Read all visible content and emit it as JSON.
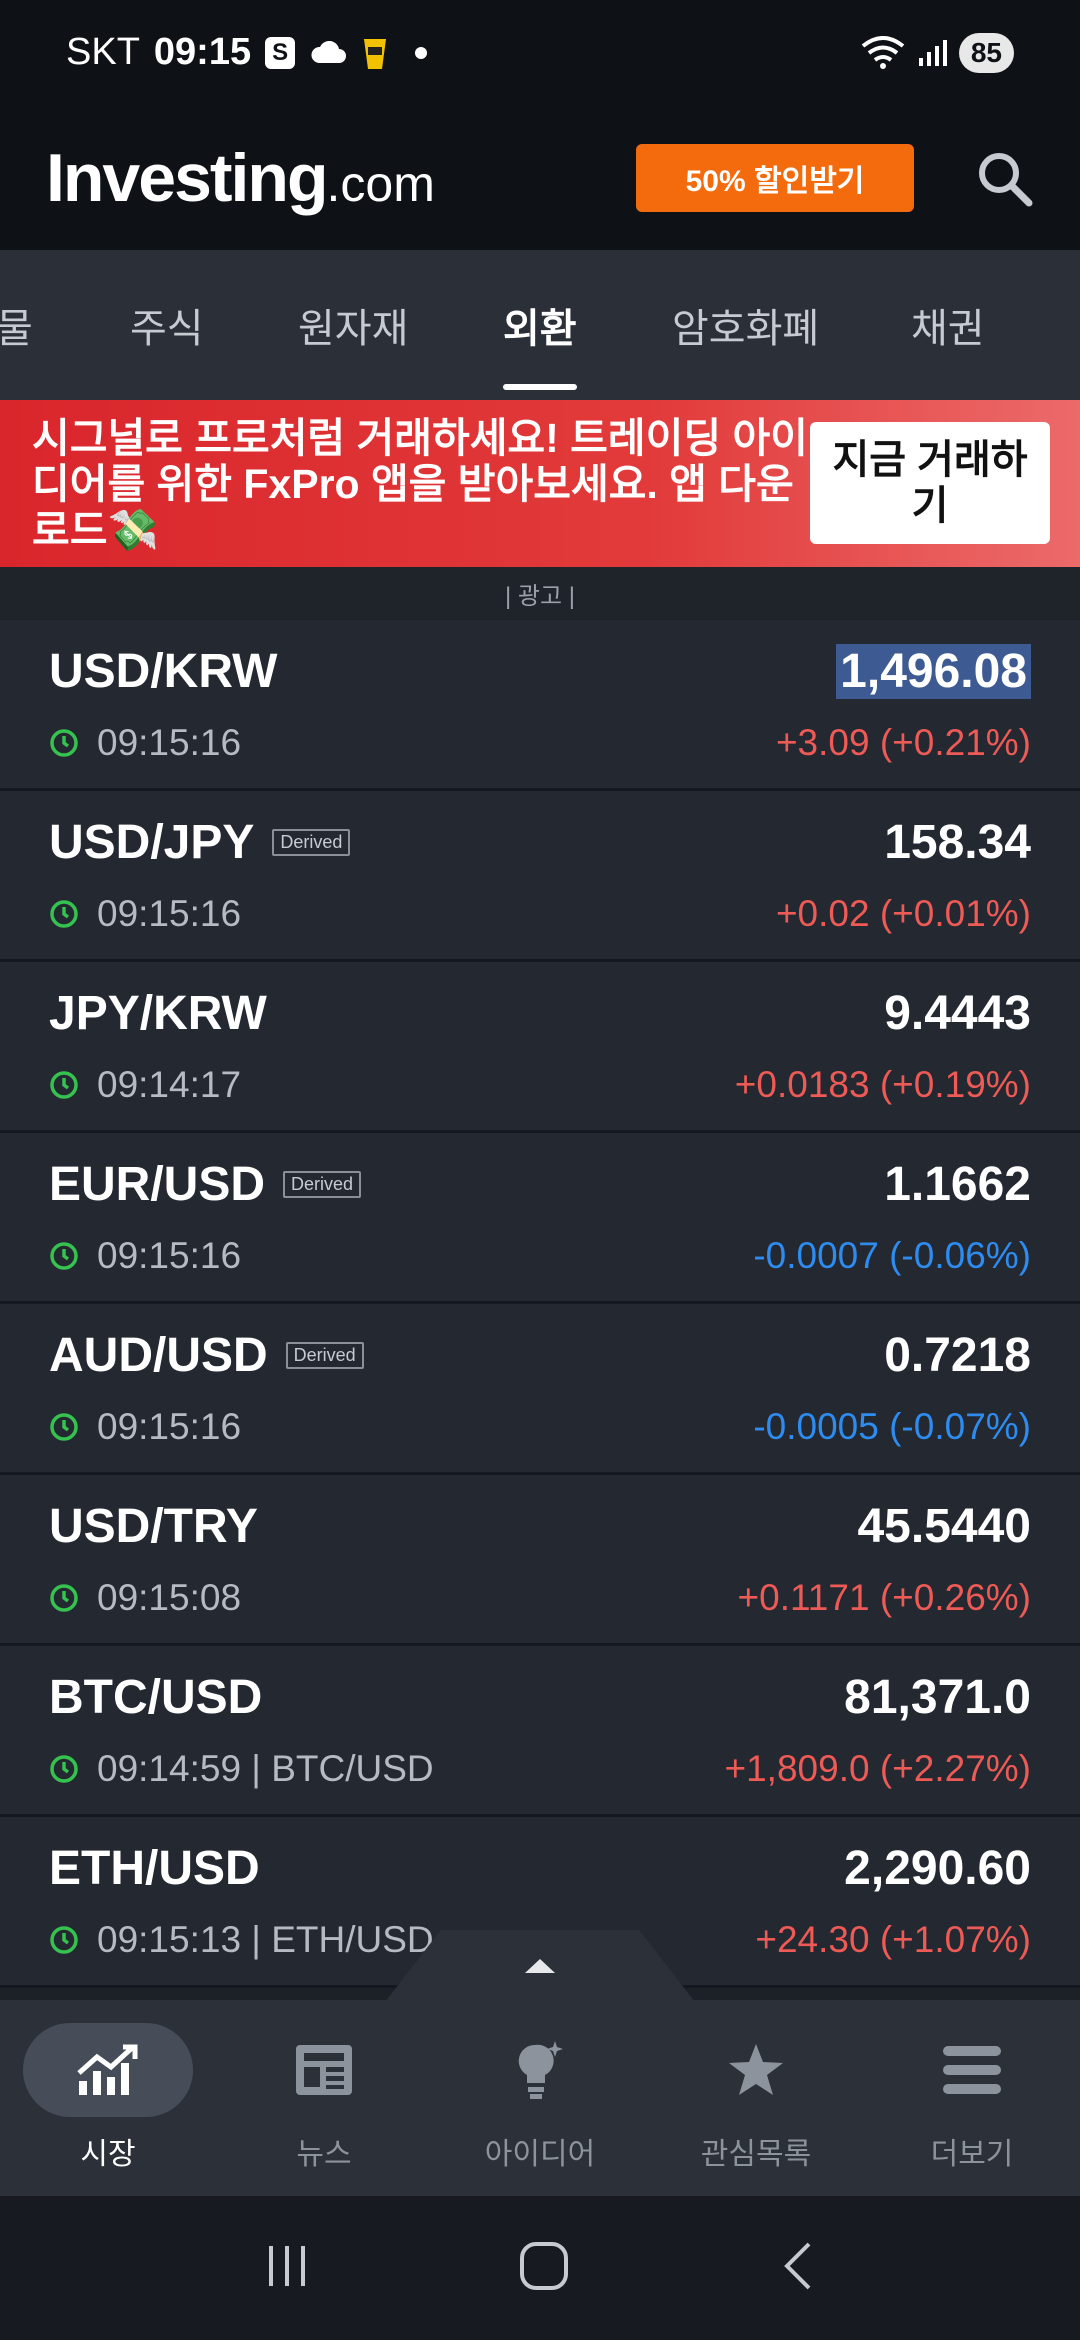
{
  "status_bar": {
    "carrier": "SKT",
    "time": "09:15",
    "battery": "85",
    "icons": [
      "samsung-s-icon",
      "cloud-icon",
      "cup-icon",
      "dot-icon",
      "wifi-icon",
      "signal-icon",
      "battery-icon"
    ]
  },
  "header": {
    "logo_main": "Investing",
    "logo_suffix": ".com",
    "promo_label": "50% 할인받기",
    "search_icon": "search-icon"
  },
  "tabs": [
    {
      "label": "물",
      "active": false
    },
    {
      "label": "주식",
      "active": false
    },
    {
      "label": "원자재",
      "active": false
    },
    {
      "label": "외환",
      "active": true
    },
    {
      "label": "암호화폐",
      "active": false
    },
    {
      "label": "채권",
      "active": false
    }
  ],
  "ad": {
    "text": "시그널로 프로처럼 거래하세요! 트레이딩 아이디어를 위한 FxPro 앱을 받아보세요. 앱 다운로드💸",
    "cta": "지금 거래하기",
    "label": "| 광고 |"
  },
  "quotes": [
    {
      "symbol": "USD/KRW",
      "derived": "",
      "time": "09:15:16",
      "price": "1,496.08",
      "change": "+3.09 (+0.21%)",
      "direction": "up",
      "highlight": true
    },
    {
      "symbol": "USD/JPY",
      "derived": "Derived",
      "time": "09:15:16",
      "price": "158.34",
      "change": "+0.02 (+0.01%)",
      "direction": "up",
      "highlight": false
    },
    {
      "symbol": "JPY/KRW",
      "derived": "",
      "time": "09:14:17",
      "price": "9.4443",
      "change": "+0.0183 (+0.19%)",
      "direction": "up",
      "highlight": false
    },
    {
      "symbol": "EUR/USD",
      "derived": "Derived",
      "time": "09:15:16",
      "price": "1.1662",
      "change": "-0.0007 (-0.06%)",
      "direction": "down",
      "highlight": false
    },
    {
      "symbol": "AUD/USD",
      "derived": "Derived",
      "time": "09:15:16",
      "price": "0.7218",
      "change": "-0.0005 (-0.07%)",
      "direction": "down",
      "highlight": false
    },
    {
      "symbol": "USD/TRY",
      "derived": "",
      "time": "09:15:08",
      "price": "45.5440",
      "change": "+0.1171 (+0.26%)",
      "direction": "up",
      "highlight": false
    },
    {
      "symbol": "BTC/USD",
      "derived": "",
      "time": "09:14:59 | BTC/USD",
      "price": "81,371.0",
      "change": "+1,809.0 (+2.27%)",
      "direction": "up",
      "highlight": false
    },
    {
      "symbol": "ETH/USD",
      "derived": "",
      "time": "09:15:13 | ETH/USD",
      "price": "2,290.60",
      "change": "+24.30 (+1.07%)",
      "direction": "up",
      "highlight": false
    }
  ],
  "bottom_nav": [
    {
      "label": "시장",
      "icon": "chart-icon",
      "active": true
    },
    {
      "label": "뉴스",
      "icon": "newspaper-icon",
      "active": false
    },
    {
      "label": "아이디어",
      "icon": "lightbulb-icon",
      "active": false
    },
    {
      "label": "관심목록",
      "icon": "star-icon",
      "active": false
    },
    {
      "label": "더보기",
      "icon": "menu-icon",
      "active": false
    }
  ],
  "colors": {
    "up": "#ee5a55",
    "down": "#2e8cf0",
    "promo": "#f46b0e",
    "ad": "#d9262c"
  }
}
